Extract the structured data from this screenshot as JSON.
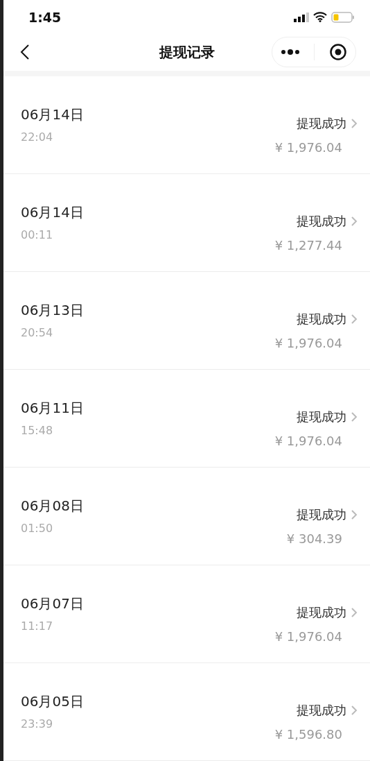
{
  "status_bar": {
    "time": "1:45"
  },
  "nav": {
    "title": "提现记录"
  },
  "records": [
    {
      "date": "06月14日",
      "time": "22:04",
      "status": "提现成功",
      "amount": "¥ 1,976.04"
    },
    {
      "date": "06月14日",
      "time": "00:11",
      "status": "提现成功",
      "amount": "¥ 1,277.44"
    },
    {
      "date": "06月13日",
      "time": "20:54",
      "status": "提现成功",
      "amount": "¥ 1,976.04"
    },
    {
      "date": "06月11日",
      "time": "15:48",
      "status": "提现成功",
      "amount": "¥ 1,976.04"
    },
    {
      "date": "06月08日",
      "time": "01:50",
      "status": "提现成功",
      "amount": "¥ 304.39"
    },
    {
      "date": "06月07日",
      "time": "11:17",
      "status": "提现成功",
      "amount": "¥ 1,976.04"
    },
    {
      "date": "06月05日",
      "time": "23:39",
      "status": "提现成功",
      "amount": "¥ 1,596.80"
    }
  ]
}
